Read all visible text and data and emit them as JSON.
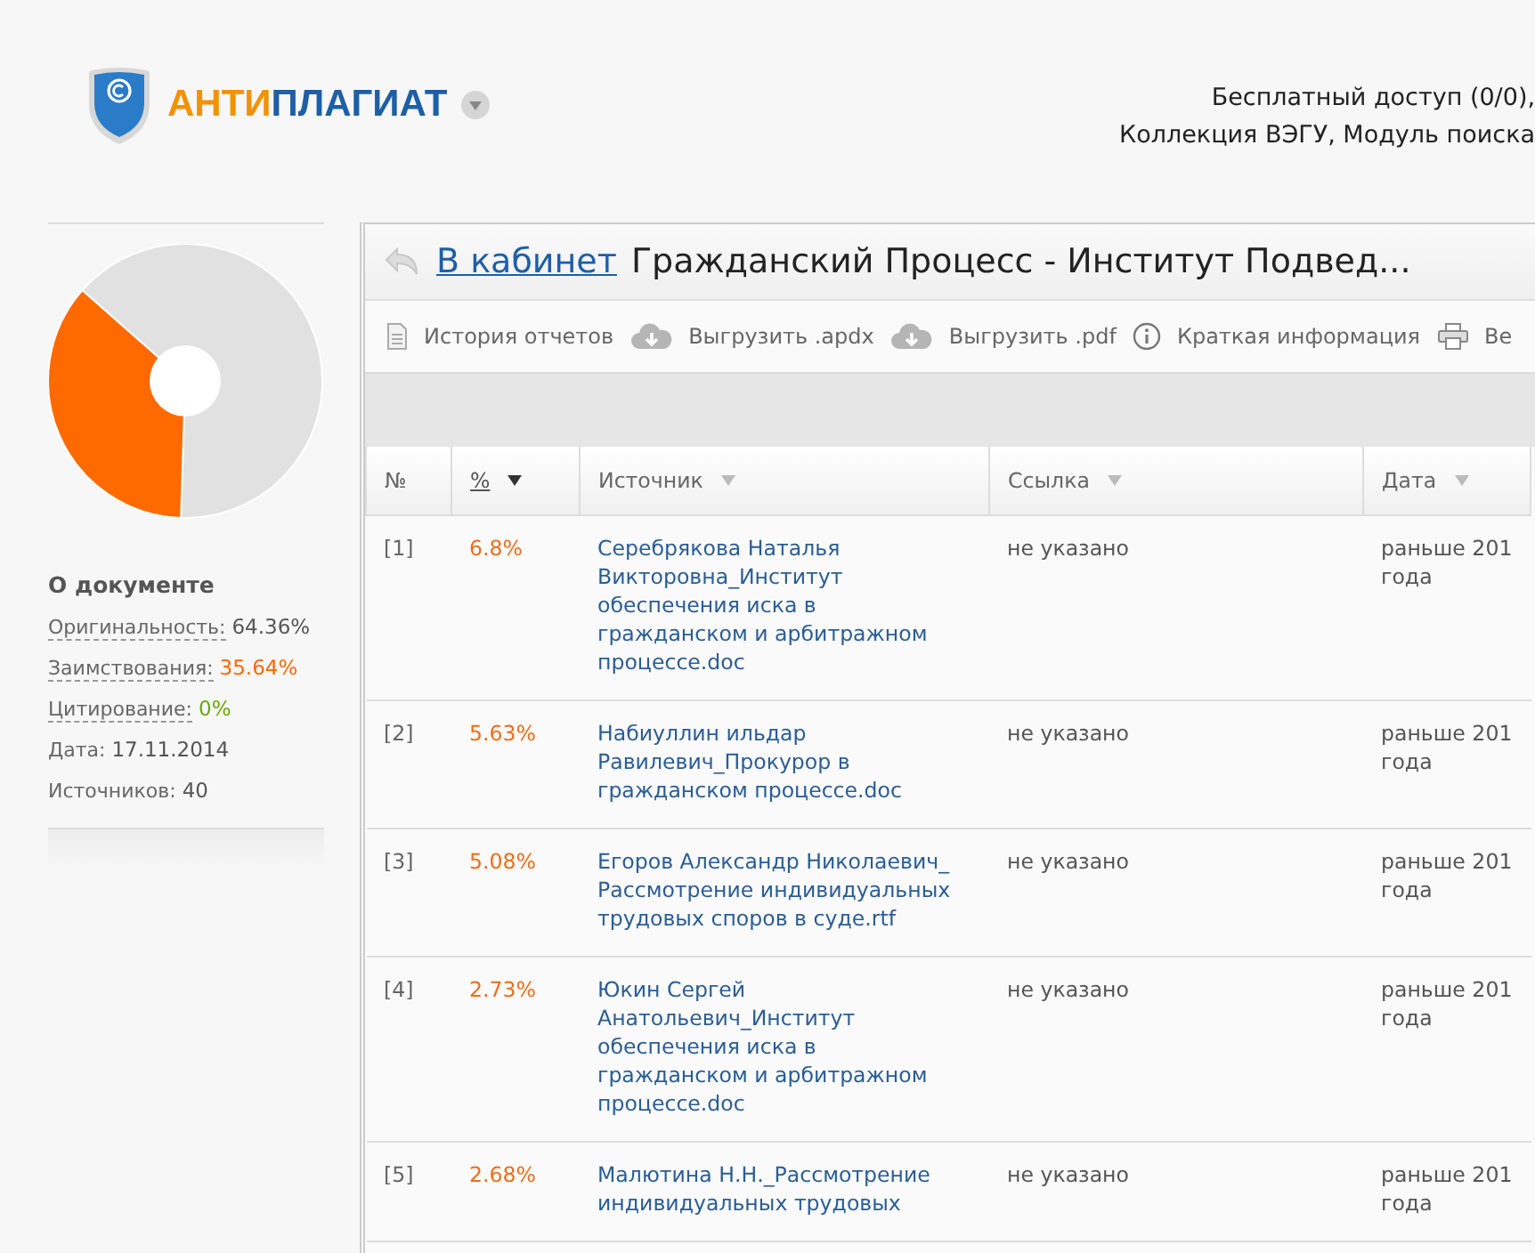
{
  "header": {
    "logo": {
      "part_1": "АНТИ",
      "part_2": "ПЛАГИАТ"
    },
    "account_lines": [
      "Бесплатный доступ (0/0),",
      "Коллекция ВЭГУ, Модуль поиска"
    ]
  },
  "sidebar": {
    "heading": "О документе",
    "stats": [
      {
        "kind": "term",
        "label": "Оригинальность:",
        "value": "64.36%",
        "color": "#555555"
      },
      {
        "kind": "term",
        "label": "Заимствования:",
        "value": "35.64%",
        "color": "#ff6600"
      },
      {
        "kind": "term",
        "label": "Цитирование:",
        "value": "0%",
        "color": "#66aa00"
      },
      {
        "kind": "plain",
        "label": "Дата:",
        "value": "17.11.2014",
        "color": "#555555"
      },
      {
        "kind": "plain",
        "label": "Источников:",
        "value": "40",
        "color": "#555555"
      }
    ]
  },
  "report": {
    "back_link": "В кабинет",
    "title": "Гражданский Процесс - Институт Подвед...",
    "toolbar": [
      {
        "kind": "document",
        "label": "История отчетов"
      },
      {
        "kind": "download",
        "label": "Выгрузить .apdx"
      },
      {
        "kind": "download",
        "label": "Выгрузить .pdf"
      },
      {
        "kind": "info",
        "label": "Краткая информация"
      },
      {
        "kind": "print",
        "label": "Ве"
      }
    ],
    "table": {
      "columns": [
        {
          "label": "№",
          "sortable": false,
          "sorted": false
        },
        {
          "label": "%",
          "sortable": true,
          "sorted": true
        },
        {
          "label": "Источник",
          "sortable": true,
          "sorted": false
        },
        {
          "label": "Ссылка",
          "sortable": true,
          "sorted": false
        },
        {
          "label": "Дата",
          "sortable": true,
          "sorted": false
        }
      ],
      "rows": [
        {
          "number": "[1]",
          "percent": "6.8%",
          "source": "Серебрякова Наталья Викторовна_Институт обеспечения иска в гражданском и арбитражном процессе.doc",
          "link": "не указано",
          "date_lines": [
            "раньше 201",
            "года"
          ]
        },
        {
          "number": "[2]",
          "percent": "5.63%",
          "source": "Набиуллин ильдар Равилевич_Прокурор в гражданском процессе.doc",
          "link": "не указано",
          "date_lines": [
            "раньше 201",
            "года"
          ]
        },
        {
          "number": "[3]",
          "percent": "5.08%",
          "source": "Егоров Александр Николаевич_  Рассмотрение индивидуальных трудовых споров в суде.rtf",
          "link": "не указано",
          "date_lines": [
            "раньше 201",
            "года"
          ]
        },
        {
          "number": "[4]",
          "percent": "2.73%",
          "source": "Юкин Сергей Анатольевич_Институт обеспечения иска в гражданском и арбитражном процессе.doc",
          "link": "не указано",
          "date_lines": [
            "раньше 201",
            "года"
          ]
        },
        {
          "number": "[5]",
          "percent": "2.68%",
          "source": "Малютина Н.Н._Рассмотрение индивидуальных трудовых",
          "link": "не указано",
          "date_lines": [
            "раньше 201",
            "года"
          ]
        }
      ]
    }
  }
}
